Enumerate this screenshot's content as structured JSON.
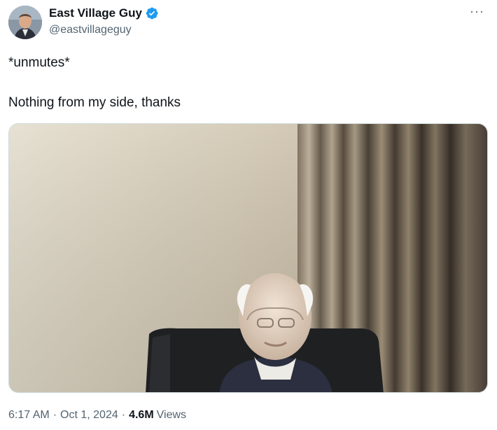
{
  "author": {
    "name": "East Village Guy",
    "handle": "@eastvillageguy",
    "verified": true,
    "verified_color": "#1d9bf0"
  },
  "menu": {
    "more_label": "···"
  },
  "tweet": {
    "lines": [
      "*unmutes*",
      "Nothing from my side, thanks"
    ]
  },
  "footer": {
    "time": "6:17 AM",
    "separator": "·",
    "date": "Oct 1, 2024",
    "views_count": "4.6M",
    "views_label": "Views"
  },
  "colors": {
    "text": "#0f1419",
    "secondary": "#536471",
    "accent": "#1d9bf0"
  }
}
